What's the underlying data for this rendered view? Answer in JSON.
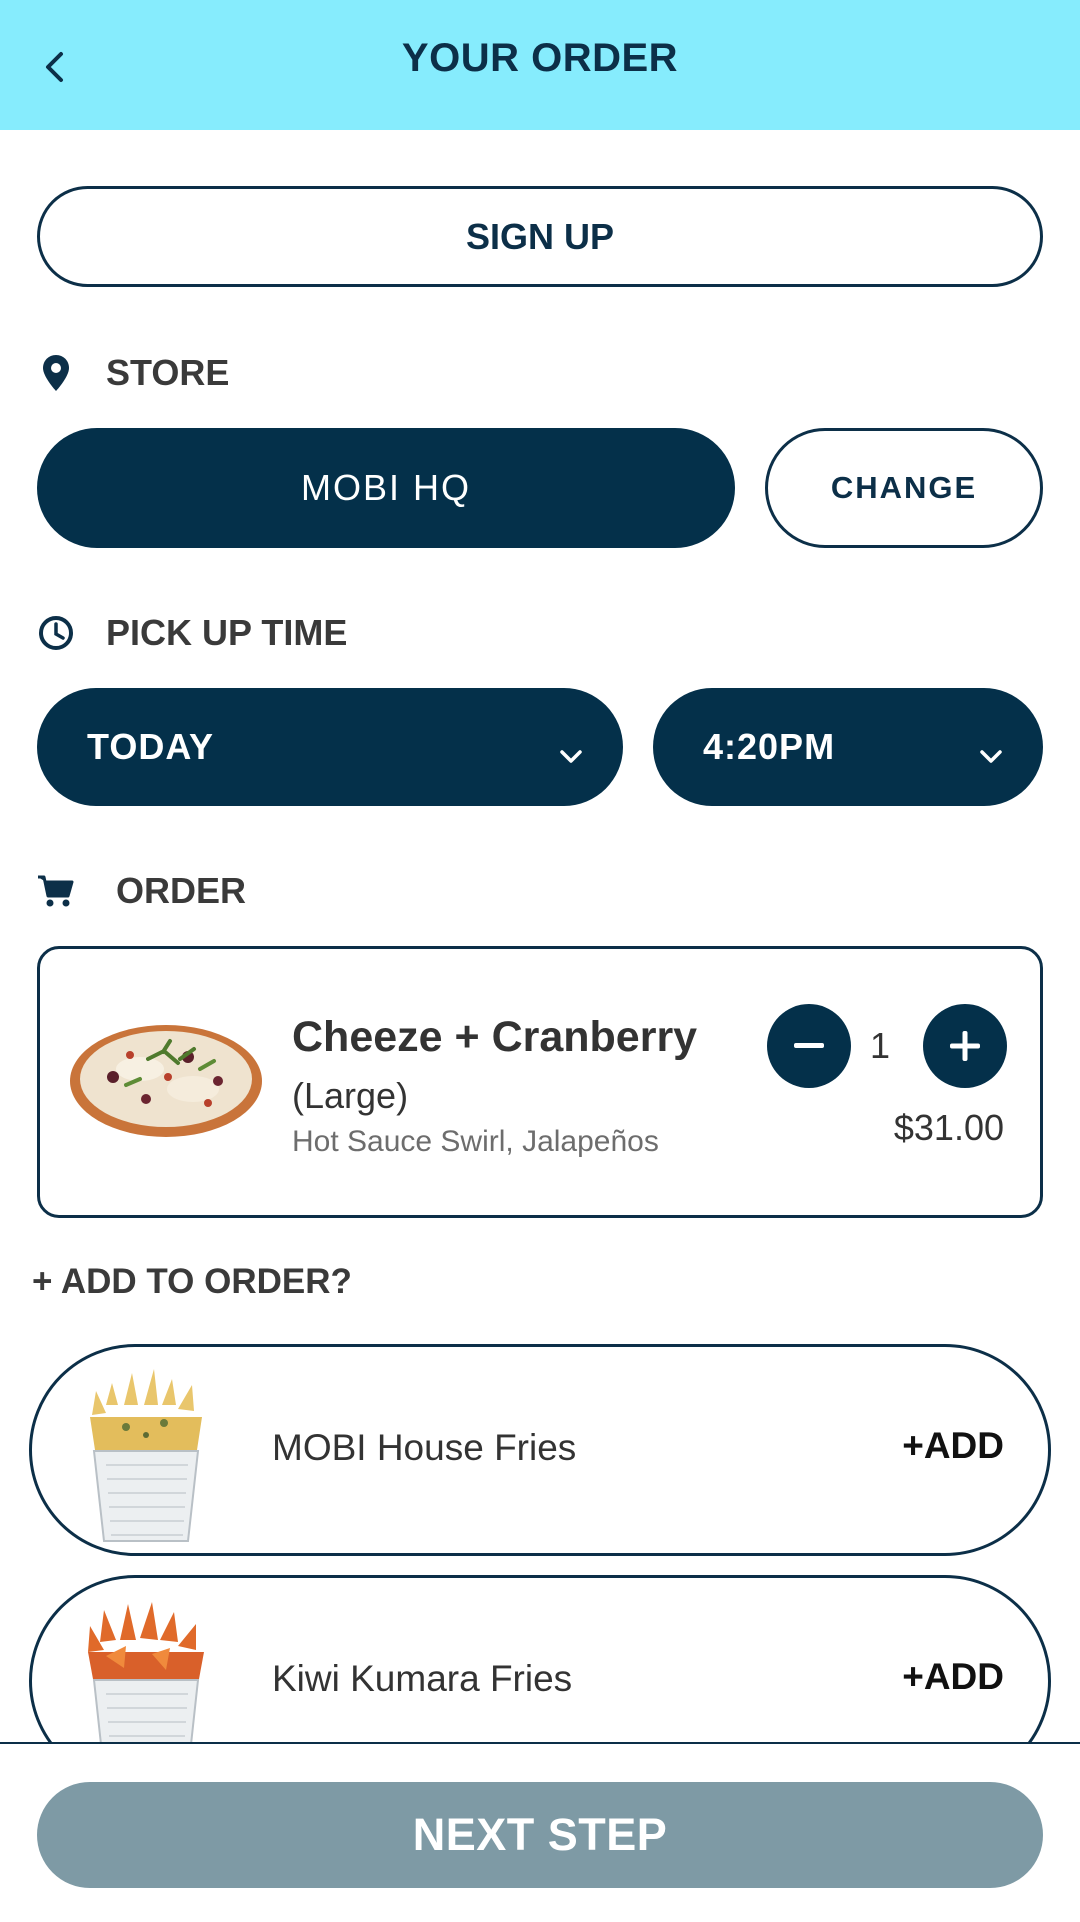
{
  "header": {
    "title": "YOUR ORDER"
  },
  "signup": {
    "label": "SIGN UP"
  },
  "store": {
    "section_label": "STORE",
    "selected": "MOBI HQ",
    "change_label": "CHANGE"
  },
  "pickup": {
    "section_label": "PICK UP TIME",
    "day": "TODAY",
    "time": "4:20PM"
  },
  "order": {
    "section_label": "ORDER",
    "item": {
      "name": "Cheeze + Cranberry",
      "size": "(Large)",
      "modifiers": "Hot Sauce Swirl, Jalapeños",
      "quantity": "1",
      "price": "$31.00"
    }
  },
  "add_to_order": {
    "label": "+ ADD TO ORDER?",
    "items": [
      {
        "name": "MOBI House Fries",
        "add_label": "+ADD"
      },
      {
        "name": "Kiwi Kumara Fries",
        "add_label": "+ADD"
      }
    ]
  },
  "footer": {
    "next_label": "NEXT STEP"
  },
  "colors": {
    "header_bg": "#86ecfd",
    "navy": "#04304a",
    "disabled_button": "#7e9aa5"
  },
  "icons": [
    "chevron-left-icon",
    "location-pin-icon",
    "clock-icon",
    "cart-icon",
    "chevron-down-icon",
    "minus-icon",
    "plus-icon"
  ]
}
